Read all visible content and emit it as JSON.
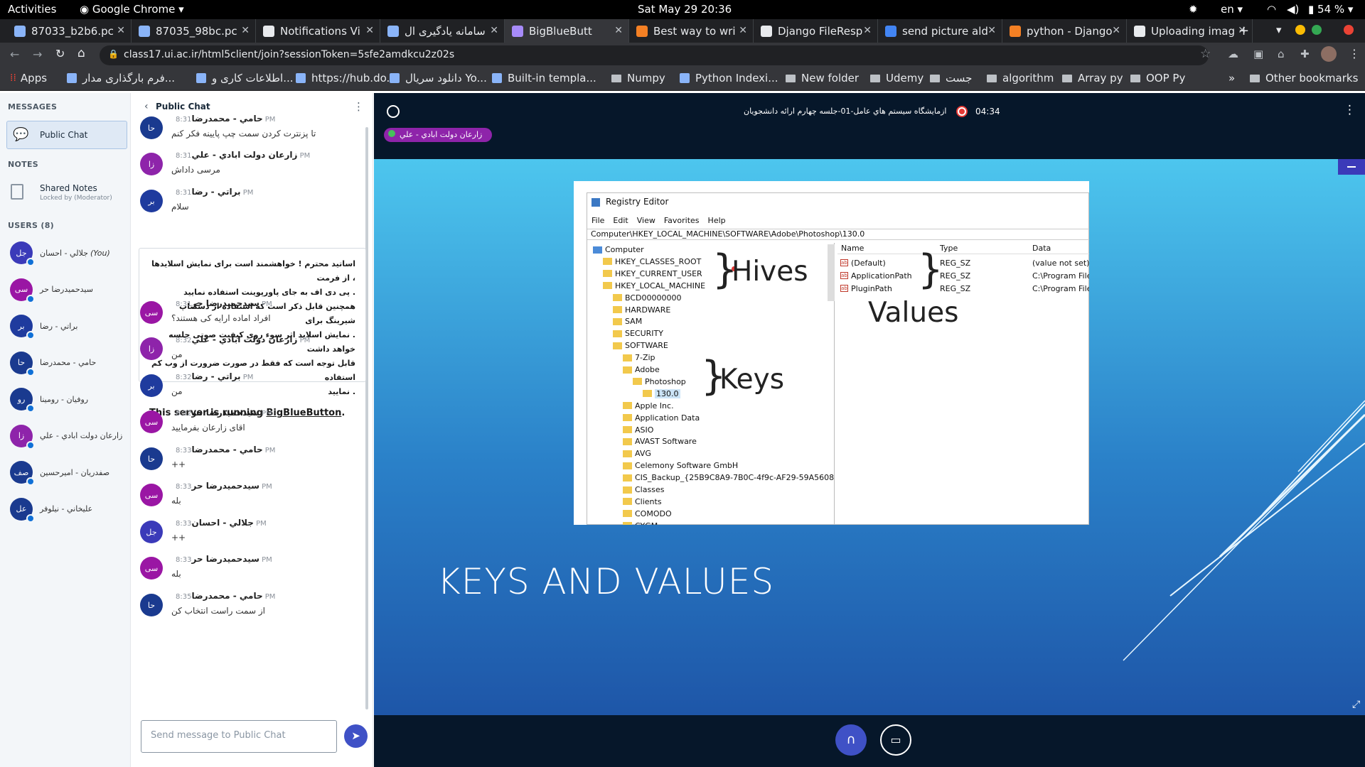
{
  "topbar": {
    "activities": "Activities",
    "app": "Google Chrome",
    "datetime": "Sat May 29  20:36",
    "lang": "en",
    "battery": "54 %"
  },
  "tabs": [
    {
      "label": "87033_b2b6.pc",
      "active": false,
      "color": "#8ab4f8"
    },
    {
      "label": "87035_98bc.pc",
      "active": false,
      "color": "#8ab4f8"
    },
    {
      "label": "Notifications Vi",
      "active": false,
      "color": "#e8eaed"
    },
    {
      "label": "سامانه یادگیری ال",
      "active": false,
      "color": "#8ab4f8"
    },
    {
      "label": "BigBlueButt",
      "active": true,
      "color": "#a78bfa"
    },
    {
      "label": "Best way to wri",
      "active": false,
      "color": "#f48024"
    },
    {
      "label": "Django FileResp",
      "active": false,
      "color": "#e8eaed"
    },
    {
      "label": "send picture ald",
      "active": false,
      "color": "#4285f4"
    },
    {
      "label": "python - Django",
      "active": false,
      "color": "#f48024"
    },
    {
      "label": "Uploading imag",
      "active": false,
      "color": "#e8eaed"
    }
  ],
  "omnibox": {
    "url": "class17.ui.ac.ir/html5client/join?sessionToken=5sfe2amdkcu2z02s"
  },
  "bookmarks": [
    {
      "label": "Apps",
      "icon": "apps-icon"
    },
    {
      "label": "فرم بارگذاری مدار...",
      "icon": "page-icon"
    },
    {
      "label": "اطلاعات کاری و...",
      "icon": "page-icon"
    },
    {
      "label": "https://hub.do...",
      "icon": "page-icon"
    },
    {
      "label": "دانلود سریال Yo...",
      "icon": "page-icon"
    },
    {
      "label": "Built-in templa...",
      "icon": "page-icon"
    },
    {
      "label": "Numpy",
      "icon": "folder-icon"
    },
    {
      "label": "Python Indexi...",
      "icon": "page-icon"
    },
    {
      "label": "New folder",
      "icon": "folder-icon"
    },
    {
      "label": "Udemy",
      "icon": "folder-icon"
    },
    {
      "label": "جست",
      "icon": "folder-icon"
    },
    {
      "label": "algorithm",
      "icon": "folder-icon"
    },
    {
      "label": "Array py",
      "icon": "folder-icon"
    },
    {
      "label": "OOP Py",
      "icon": "folder-icon"
    },
    {
      "label": "»",
      "icon": "chevron-icon"
    },
    {
      "label": "Other bookmarks",
      "icon": "folder-icon"
    }
  ],
  "left": {
    "messages_header": "MESSAGES",
    "public_chat": "Public Chat",
    "notes_header": "NOTES",
    "shared_notes": "Shared Notes",
    "shared_notes_sub": "Locked by (Moderator)",
    "users_header": "USERS (8)",
    "users": [
      {
        "initials": "جل",
        "name": "جلالي - احسان",
        "you": "(You)",
        "color": "#3b3ab9"
      },
      {
        "initials": "سی",
        "name": "سيدحميدرضا حر",
        "you": "",
        "color": "#9a16a4"
      },
      {
        "initials": "بر",
        "name": "براتي - رضا",
        "you": "",
        "color": "#1f3b9e"
      },
      {
        "initials": "حا",
        "name": "حامي - محمدرضا",
        "you": "",
        "color": "#1a3a8f"
      },
      {
        "initials": "رو",
        "name": "روفيان - رومينا",
        "you": "",
        "color": "#1a3a8f"
      },
      {
        "initials": "زا",
        "name": "زارعان دولت ابادي - علي",
        "you": "",
        "color": "#8e24aa"
      },
      {
        "initials": "صف",
        "name": "صفدريان - اميرحسين",
        "you": "",
        "color": "#1a3a8f"
      },
      {
        "initials": "عل",
        "name": "عليخاني - نيلوفر",
        "you": "",
        "color": "#1a3a8f"
      }
    ]
  },
  "chat": {
    "title": "Public Chat",
    "messages_top": [
      {
        "initials": "حا",
        "name": "حامي - محمدرضا",
        "time": "8:31 PM",
        "text": "تا پزنترت کردن سمت چپ پایینه فکر کنم",
        "color": "#1a3a8f"
      },
      {
        "initials": "زا",
        "name": "زارعان دولت ابادي - علي",
        "time": "8:31 PM",
        "text": "مرسی داداش",
        "color": "#8e24aa"
      },
      {
        "initials": "بر",
        "name": "براتي - رضا",
        "time": "8:31 PM",
        "text": "سلام",
        "color": "#1f3b9e"
      }
    ],
    "welcome": {
      "l1": "اساتید محترم ! خواهشمند است برای نمایش اسلایدها ، از فرمت",
      "l2": ". پی دی اف به جای پاورپوینت استفاده نمایید",
      "l3": "همچنین قابل ذکر است که استفاده از دسکتاپ شیرینگ برای",
      "l4": ". نمایش اسلاید اثر سوء روی کیفیت صوتی جلسه خواهد داشت",
      "l5": "قابل توجه است که فقط در صورت ضرورت از وب کم استفاده",
      "l6": ". نمایید",
      "server_prefix": "This server is running ",
      "server_link": "BigBlueButton",
      "server_suffix": "."
    },
    "messages": [
      {
        "initials": "سی",
        "name": "سيدحميدرضا حر",
        "time": "8:31 PM",
        "text": "افراد اماده ارایه کی هستند؟",
        "color": "#9a16a4"
      },
      {
        "initials": "زا",
        "name": "زارعان دولت ابادي - علي",
        "time": "8:32 PM",
        "text": "من",
        "color": "#8e24aa"
      },
      {
        "initials": "بر",
        "name": "براتي - رضا",
        "time": "8:32 PM",
        "text": "من",
        "color": "#1f3b9e"
      },
      {
        "initials": "سی",
        "name": "سيدحميدرضا حر",
        "time": "8:32 PM",
        "text": "اقای زارعان بفرمایید",
        "color": "#9a16a4"
      },
      {
        "initials": "حا",
        "name": "حامي - محمدرضا",
        "time": "8:33 PM",
        "text": "++",
        "color": "#1a3a8f"
      },
      {
        "initials": "سی",
        "name": "سيدحميدرضا حر",
        "time": "8:33 PM",
        "text": "بله",
        "color": "#9a16a4"
      },
      {
        "initials": "جل",
        "name": "جلالي - احسان",
        "time": "8:33 PM",
        "text": "++",
        "color": "#3b3ab9"
      },
      {
        "initials": "سی",
        "name": "سيدحميدرضا حر",
        "time": "8:33 PM",
        "text": "بله",
        "color": "#9a16a4"
      },
      {
        "initials": "حا",
        "name": "حامي - محمدرضا",
        "time": "8:35 PM",
        "text": "از سمت راست انتخاب کن",
        "color": "#1a3a8f"
      }
    ],
    "input_placeholder": "Send message to Public Chat"
  },
  "meeting": {
    "title": "ازمايشگاه سيستم هاي عامل-01-جلسه چهارم ارائه دانشجويان",
    "recording_time": "04:34",
    "talker": "زارعان دولت ابادي - علي"
  },
  "slide": {
    "heading": "KEYS AND VALUES",
    "regedit": {
      "title": "Registry Editor",
      "menu": [
        "File",
        "Edit",
        "View",
        "Favorites",
        "Help"
      ],
      "path": "Computer\\HKEY_LOCAL_MACHINE\\SOFTWARE\\Adobe\\Photoshop\\130.0",
      "tree": [
        "Computer",
        "HKEY_CLASSES_ROOT",
        "HKEY_CURRENT_USER",
        "HKEY_LOCAL_MACHINE",
        "BCD00000000",
        "HARDWARE",
        "SAM",
        "SECURITY",
        "SOFTWARE",
        "7-Zip",
        "Adobe",
        "Photoshop",
        "130.0",
        "Apple Inc.",
        "Application Data",
        "ASIO",
        "AVAST Software",
        "AVG",
        "Celemony Software GmbH",
        "CIS_Backup_{25B9C8A9-7B0C-4f9c-AF29-59A5608",
        "Classes",
        "Clients",
        "COMODO",
        "CYGM"
      ],
      "columns": [
        "Name",
        "Type",
        "Data"
      ],
      "rows": [
        {
          "name": "(Default)",
          "type": "REG_SZ",
          "data": "(value not set)"
        },
        {
          "name": "ApplicationPath",
          "type": "REG_SZ",
          "data": "C:\\Program File"
        },
        {
          "name": "PluginPath",
          "type": "REG_SZ",
          "data": "C:\\Program File"
        }
      ],
      "hives_label": "Hives",
      "values_label": "Values",
      "keys_label": "Keys"
    }
  }
}
